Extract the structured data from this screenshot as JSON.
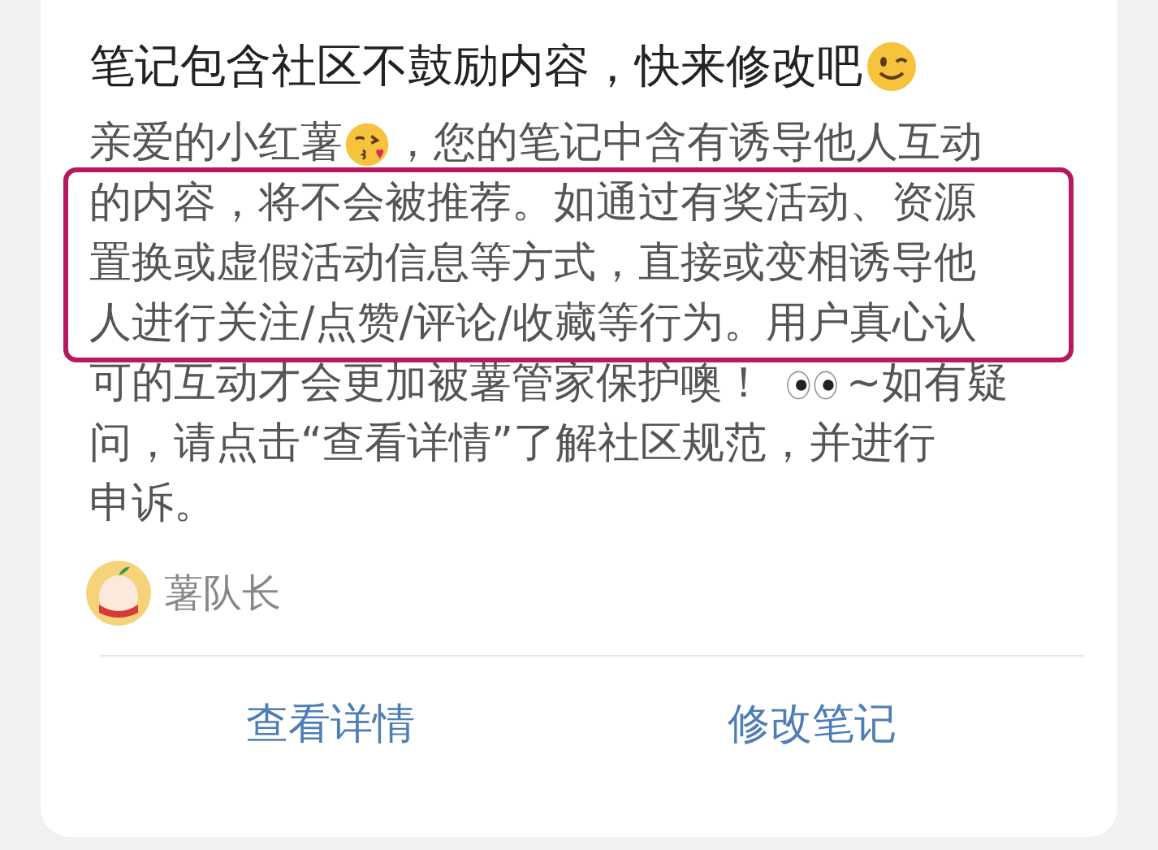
{
  "notice": {
    "title": "笔记包含社区不鼓励内容，快来修改吧",
    "lines": [
      [
        {
          "kind": "text",
          "text": "亲爱的小红薯"
        },
        {
          "kind": "kiss-emoji"
        },
        {
          "kind": "text",
          "text": "，您的笔记中含有诱导他人互动"
        }
      ],
      [
        {
          "kind": "text",
          "text": "的内容，将不会被推荐。如通过有奖活动、资源"
        }
      ],
      [
        {
          "kind": "text",
          "text": "置换或虚假活动信息等方式，直接或变相诱导他"
        }
      ],
      [
        {
          "kind": "text",
          "text": "人进行关注/点赞/评论/收藏等行为。用户真心认"
        }
      ],
      [
        {
          "kind": "text",
          "text": "可的互动才会更加被薯管家保护噢！"
        },
        {
          "kind": "eyes-emoji"
        },
        {
          "kind": "text",
          "text": "~如有疑"
        }
      ],
      [
        {
          "kind": "text",
          "text": "问，请点击“查看详情”了解社区规范，并进行"
        }
      ],
      [
        {
          "kind": "text",
          "text": "申诉。"
        }
      ]
    ]
  },
  "author": {
    "name": "薯队长"
  },
  "actions": [
    "查看详情",
    "修改笔记"
  ]
}
